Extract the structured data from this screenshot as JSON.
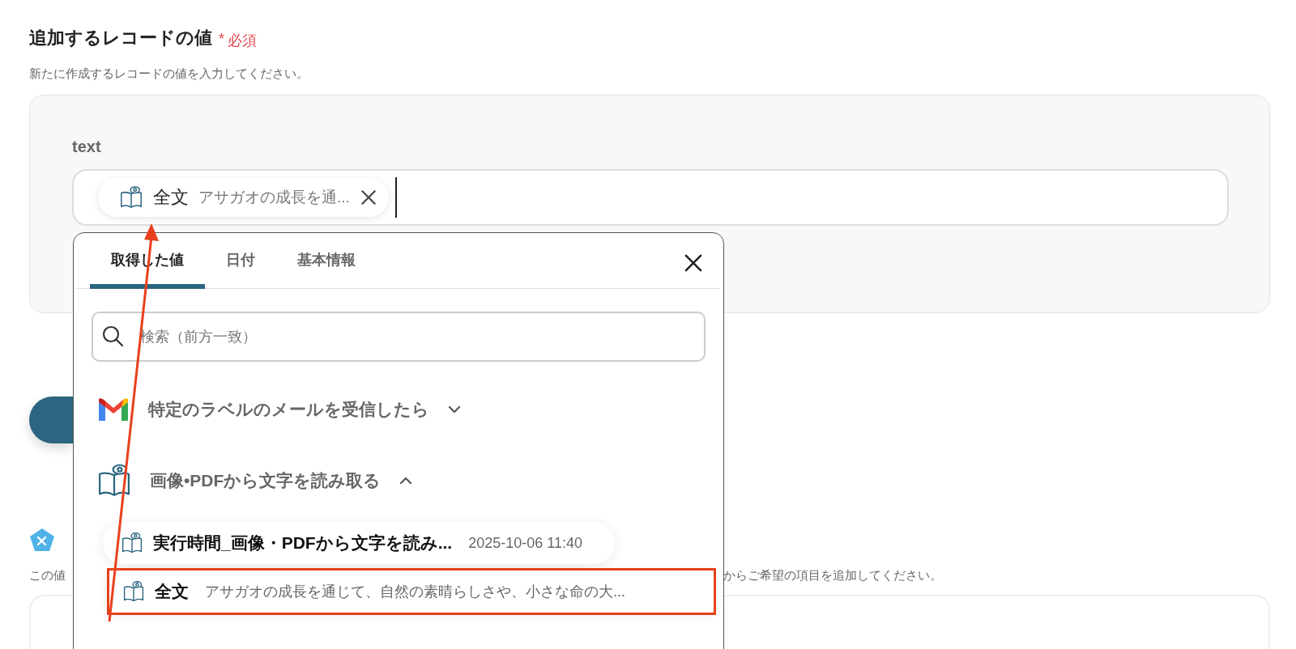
{
  "section": {
    "title": "追加するレコードの値",
    "required_mark": "*",
    "required_label": "必須",
    "description": "新たに作成するレコードの値を入力してください。"
  },
  "field": {
    "label": "text",
    "chip": {
      "name": "全文",
      "value": "アサガオの成長を通..."
    }
  },
  "picker": {
    "tabs": [
      {
        "label": "取得した値",
        "selected": true
      },
      {
        "label": "日付",
        "selected": false
      },
      {
        "label": "基本情報",
        "selected": false
      }
    ],
    "search": {
      "placeholder": "検索（前方一致）"
    },
    "groups": [
      {
        "kind": "gmail",
        "title": "特定のラベルのメールを受信したら",
        "expanded": false
      },
      {
        "kind": "ocr",
        "title": "画像•PDFから文字を読み取る",
        "expanded": true,
        "items": [
          {
            "name": "実行時間_画像・PDFから文字を読み...",
            "value": "2025-10-06 11:40",
            "selected": false
          },
          {
            "name": "全文",
            "value": "アサガオの成長を通じて、自然の素晴らしさや、小さな命の大...",
            "selected": true
          }
        ]
      }
    ]
  },
  "background": {
    "note_left": "この値",
    "note_right": "からご希望の項目を追加してください。"
  }
}
